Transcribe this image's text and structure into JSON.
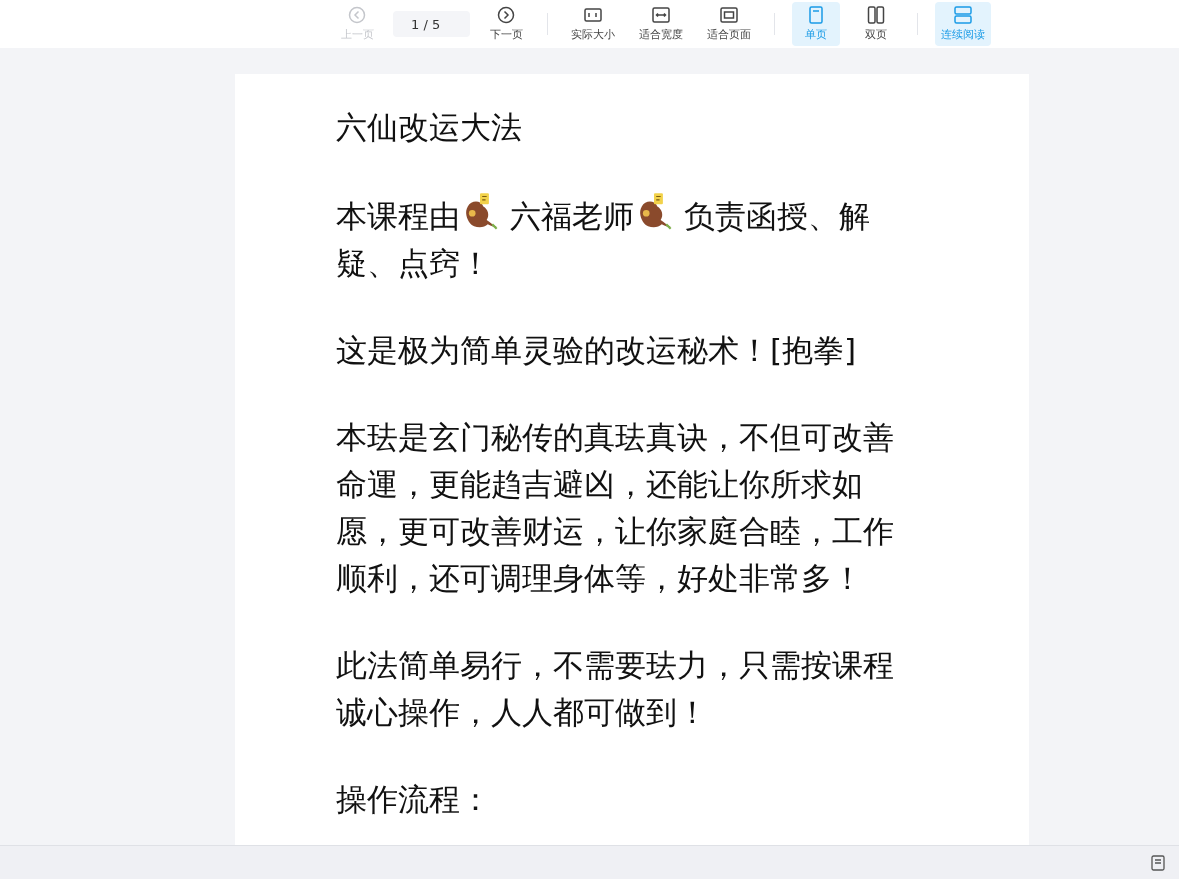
{
  "toolbar": {
    "groups": [
      {
        "items": [
          {
            "kind": "button",
            "label": "上一页",
            "disabled": true,
            "selected": false
          },
          {
            "kind": "page_input",
            "value": "1 / 5"
          },
          {
            "kind": "button",
            "label": "下一页",
            "disabled": false,
            "selected": false
          }
        ]
      },
      {
        "items": [
          {
            "kind": "button",
            "label": "实际大小",
            "disabled": false,
            "selected": false
          },
          {
            "kind": "button",
            "label": "适合宽度",
            "disabled": false,
            "selected": false
          },
          {
            "kind": "button",
            "label": "适合页面",
            "disabled": false,
            "selected": false
          }
        ]
      },
      {
        "items": [
          {
            "kind": "button",
            "label": "单页",
            "disabled": false,
            "selected": true
          },
          {
            "kind": "button",
            "label": "双页",
            "disabled": false,
            "selected": false
          }
        ]
      },
      {
        "items": [
          {
            "kind": "button",
            "label": "连续阅读",
            "disabled": false,
            "selected": true
          }
        ]
      }
    ]
  },
  "document": {
    "paragraphs": [
      {
        "segments": [
          {
            "kind": "text",
            "text": "六仙改运大法"
          }
        ]
      },
      {
        "segments": [
          {
            "kind": "text",
            "text": "本课程由"
          },
          {
            "kind": "sticker"
          },
          {
            "kind": "text",
            "text": " 六福老师"
          },
          {
            "kind": "sticker"
          },
          {
            "kind": "text",
            "text": " 负责函授、解"
          },
          {
            "kind": "text",
            "text": "疑、点窍！"
          }
        ]
      },
      {
        "segments": [
          {
            "kind": "text",
            "text": "这是极为简单灵验的改运秘术！[抱拳]"
          }
        ]
      },
      {
        "segments": [
          {
            "kind": "text",
            "text": "本珐是玄门秘传的真珐真诀，不但可改善命運，更能趋吉避凶，还能让你所求如愿，更可改善财运，让你家庭合睦，工作顺利，还可调理身体等，好处非常多！"
          }
        ]
      },
      {
        "segments": [
          {
            "kind": "text",
            "text": "此法简单易行，不需要珐力，只需按课程诚心操作，人人都可做到！"
          }
        ]
      },
      {
        "segments": [
          {
            "kind": "text",
            "text": "操作流程："
          }
        ]
      }
    ]
  }
}
